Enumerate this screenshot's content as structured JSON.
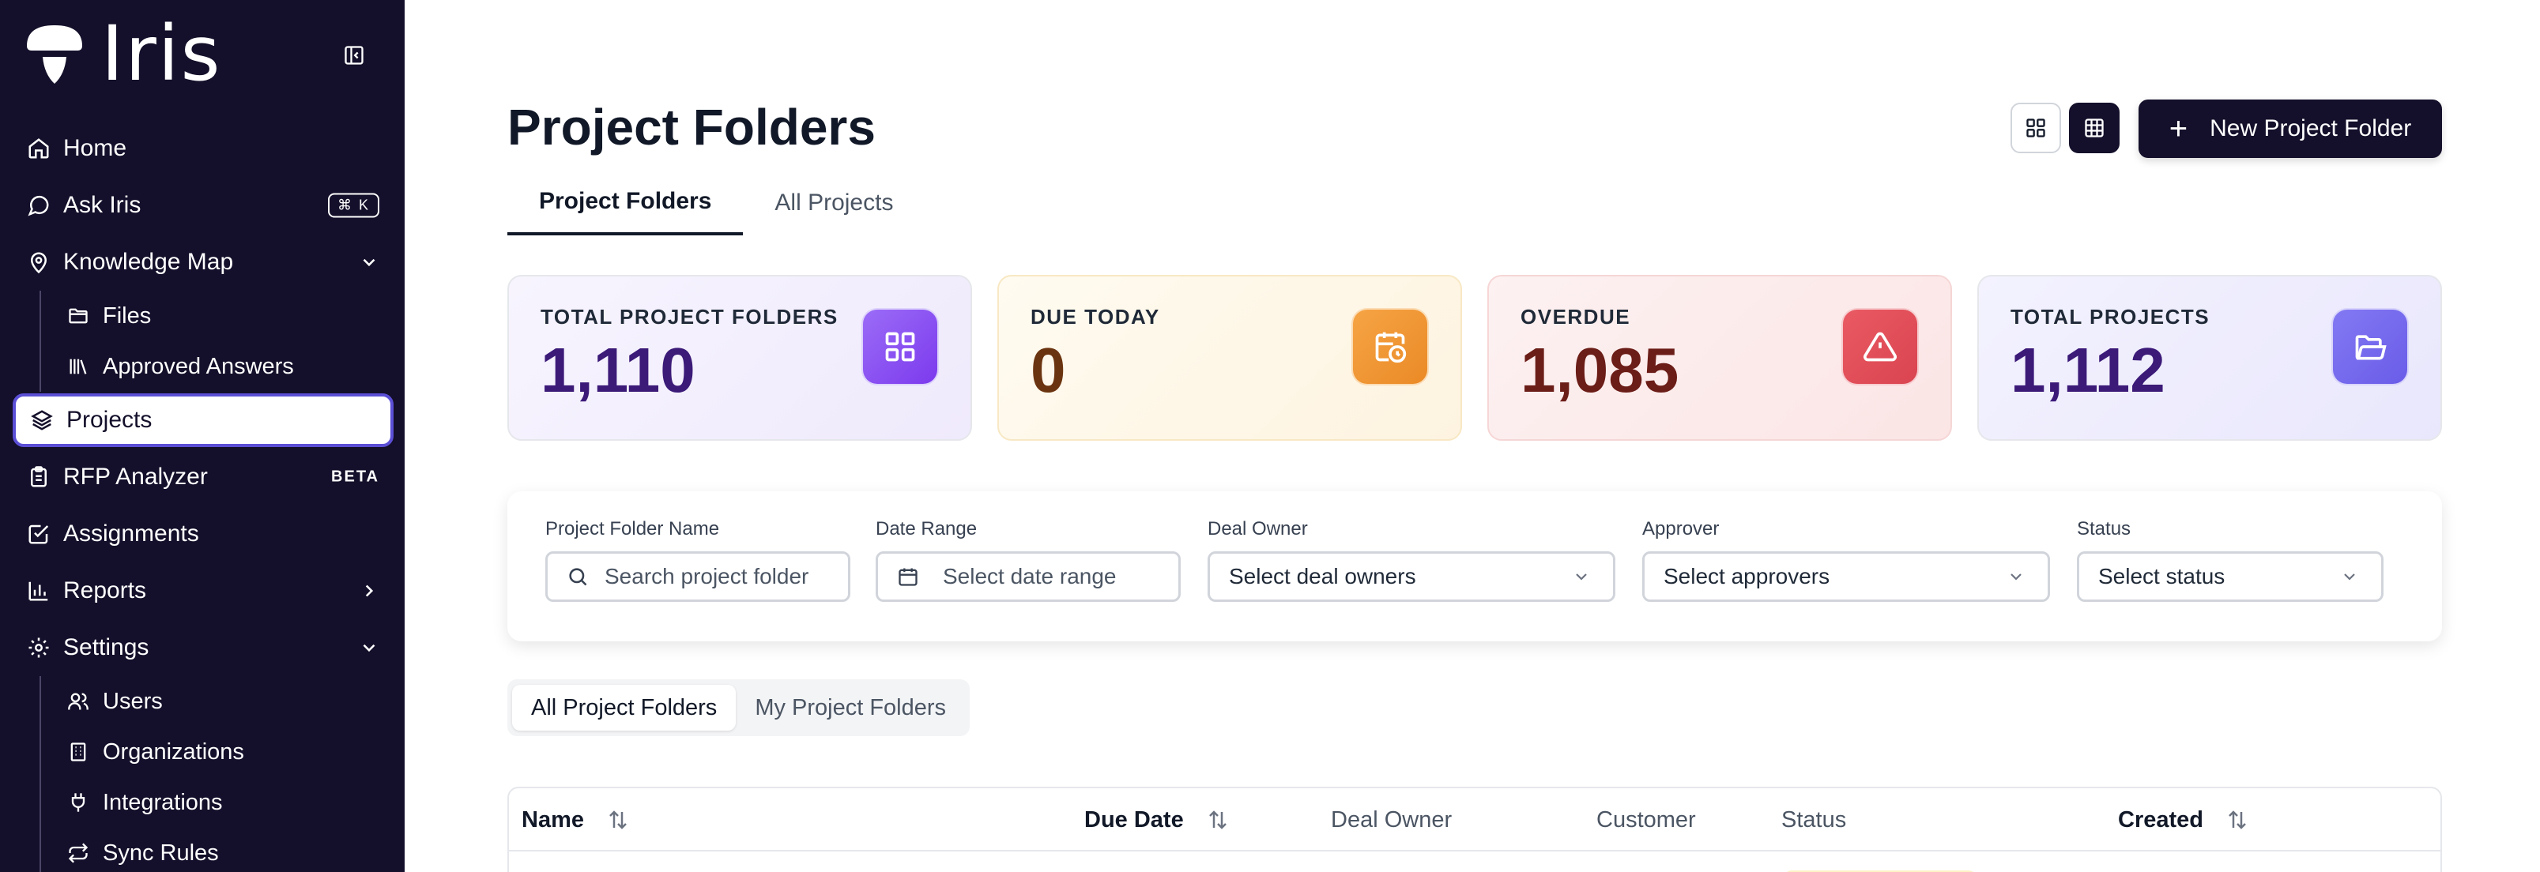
{
  "app": {
    "name": "Iris"
  },
  "sidebar": {
    "items": [
      {
        "label": "Home",
        "icon": "home-icon"
      },
      {
        "label": "Ask Iris",
        "icon": "chat-icon",
        "shortcut": "⌘ K"
      },
      {
        "label": "Knowledge Map",
        "icon": "map-pin-icon",
        "expanded": true,
        "children": [
          {
            "label": "Files",
            "icon": "folder-icon"
          },
          {
            "label": "Approved Answers",
            "icon": "library-icon"
          }
        ]
      },
      {
        "label": "Projects",
        "icon": "layers-icon",
        "active": true
      },
      {
        "label": "RFP Analyzer",
        "icon": "clipboard-icon",
        "badge": "BETA"
      },
      {
        "label": "Assignments",
        "icon": "check-square-icon"
      },
      {
        "label": "Reports",
        "icon": "bar-chart-icon"
      },
      {
        "label": "Settings",
        "icon": "gear-icon",
        "expanded": true,
        "children": [
          {
            "label": "Users",
            "icon": "users-icon"
          },
          {
            "label": "Organizations",
            "icon": "building-icon"
          },
          {
            "label": "Integrations",
            "icon": "plug-icon"
          },
          {
            "label": "Sync Rules",
            "icon": "sync-icon"
          }
        ]
      }
    ]
  },
  "header": {
    "title": "Project Folders",
    "tabs": [
      {
        "label": "Project Folders",
        "active": true
      },
      {
        "label": "All Projects",
        "active": false
      }
    ],
    "new_button": "New Project Folder",
    "view_mode": "table"
  },
  "stats": [
    {
      "label": "TOTAL PROJECT FOLDERS",
      "value": "1,110",
      "icon": "grid-icon",
      "color": "#3b1a78",
      "accent": "#8b5cf6",
      "bg": "#f4f1fd"
    },
    {
      "label": "DUE TODAY",
      "value": "0",
      "icon": "calendar-clock-icon",
      "color": "#6b3410",
      "accent": "#f39a3d",
      "bg": "#fef8ea"
    },
    {
      "label": "OVERDUE",
      "value": "1,085",
      "icon": "warning-icon",
      "color": "#6b1d17",
      "accent": "#e2505a",
      "bg": "#fdeeee"
    },
    {
      "label": "TOTAL PROJECTS",
      "value": "1,112",
      "icon": "folder-open-icon",
      "color": "#3b1a78",
      "accent": "#7c6cf0",
      "bg": "#f0effd"
    }
  ],
  "filters": {
    "name": {
      "label": "Project Folder Name",
      "placeholder": "Search project folder"
    },
    "date": {
      "label": "Date Range",
      "placeholder": "Select date range"
    },
    "deal_owner": {
      "label": "Deal Owner",
      "value": "Select deal owners"
    },
    "approver": {
      "label": "Approver",
      "value": "Select approvers"
    },
    "status": {
      "label": "Status",
      "value": "Select status"
    }
  },
  "segment": {
    "options": [
      "All Project Folders",
      "My Project Folders"
    ],
    "selected": "All Project Folders"
  },
  "table": {
    "columns": [
      "Name",
      "Due Date",
      "Deal Owner",
      "Customer",
      "Status",
      "Created"
    ]
  }
}
